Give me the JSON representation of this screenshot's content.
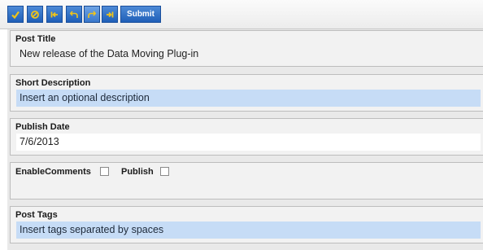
{
  "toolbar": {
    "buttons": [
      {
        "name": "save",
        "icon": "checkmark-icon"
      },
      {
        "name": "cancel",
        "icon": "cancel-icon"
      },
      {
        "name": "first",
        "icon": "skip-back-icon"
      },
      {
        "name": "undo",
        "icon": "undo-icon"
      },
      {
        "name": "redo",
        "icon": "redo-icon"
      },
      {
        "name": "last",
        "icon": "skip-forward-icon"
      }
    ],
    "submit_label": "Submit",
    "accent_color": "#2a6cc4",
    "icon_color": "#f0c419"
  },
  "form": {
    "post_title": {
      "label": "Post Title",
      "value": "New release of the Data Moving Plug-in"
    },
    "short_description": {
      "label": "Short Description",
      "placeholder": "Insert an optional description"
    },
    "publish_date": {
      "label": "Publish Date",
      "value": "7/6/2013"
    },
    "enable_comments": {
      "label": "EnableComments",
      "checked": false
    },
    "publish": {
      "label": "Publish",
      "checked": false
    },
    "post_tags": {
      "label": "Post Tags",
      "placeholder": "Insert tags separated by spaces"
    }
  }
}
